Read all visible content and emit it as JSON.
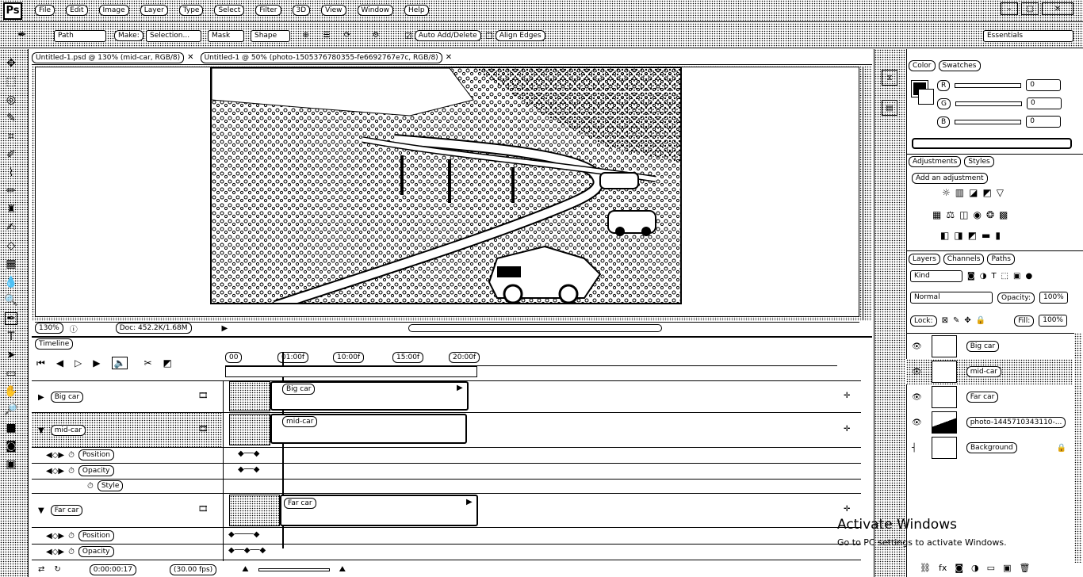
{
  "app": {
    "logo": "Ps"
  },
  "menu": [
    "File",
    "Edit",
    "Image",
    "Layer",
    "Type",
    "Select",
    "Filter",
    "3D",
    "View",
    "Window",
    "Help"
  ],
  "options": {
    "tool_mode": "Path",
    "make_label": "Make:",
    "make_buttons": [
      "Selection...",
      "Mask",
      "Shape"
    ],
    "auto_add_delete": "Auto Add/Delete",
    "align_edges": "Align Edges",
    "workspace": "Essentials"
  },
  "docs": {
    "tab1": "Untitled-1.psd @ 130% (mid-car, RGB/8)",
    "tab2": "Untitled-1 @ 50% (photo-1505376780355-fe6692767e7c, RGB/8)",
    "zoom": "130%",
    "doc_size": "Doc: 452.2K/1.68M"
  },
  "timeline": {
    "title": "Timeline",
    "ruler": [
      "00",
      "01:00f",
      "10:00f",
      "15:00f",
      "20:00f"
    ],
    "time": "0:00:00:17",
    "fps": "(30.00 fps)",
    "layers": [
      {
        "name": "Big car",
        "clip": "Big car",
        "props": []
      },
      {
        "name": "mid-car",
        "clip": "mid-car",
        "props": [
          "Position",
          "Opacity",
          "Style"
        ]
      },
      {
        "name": "Far car",
        "clip": "Far car",
        "props": [
          "Position",
          "Opacity"
        ]
      }
    ]
  },
  "color_panel": {
    "tabs": [
      "Color",
      "Swatches"
    ],
    "channels": [
      {
        "label": "R",
        "value": "0"
      },
      {
        "label": "G",
        "value": "0"
      },
      {
        "label": "B",
        "value": "0"
      }
    ]
  },
  "adjustments": {
    "tabs": [
      "Adjustments",
      "Styles"
    ],
    "title": "Add an adjustment"
  },
  "layers_panel": {
    "tabs": [
      "Layers",
      "Channels",
      "Paths"
    ],
    "filter": "Kind",
    "blend_mode": "Normal",
    "opacity_label": "Opacity:",
    "opacity_value": "100%",
    "lock_label": "Lock:",
    "fill_label": "Fill:",
    "fill_value": "100%",
    "layers": [
      "Big car",
      "mid-car",
      "Far car",
      "photo-1445710343110-...",
      "Background"
    ]
  },
  "watermark": {
    "title": "Activate Windows",
    "subtitle": "Go to PC settings to activate Windows."
  }
}
